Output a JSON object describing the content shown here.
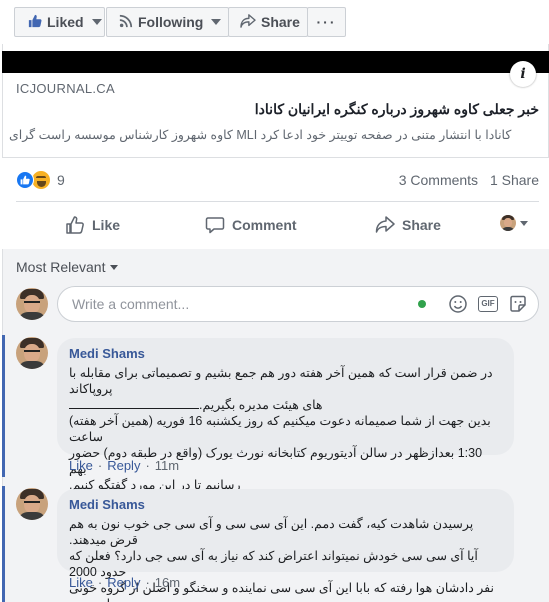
{
  "page_actions": {
    "liked_label": "Liked",
    "following_label": "Following",
    "share_label": "Share",
    "more_label": "···"
  },
  "link_preview": {
    "domain": "ICJOURNAL.CA",
    "title": "خبر جعلی کاوه شهروز درباره کنگره ایرانیان کانادا",
    "description": "کانادا با انتشار متنی در صفحه توییتر خود ادعا کرد MLI کاوه شهروز کارشناس موسسه راست گرای",
    "info_label": "i"
  },
  "reactions": {
    "count": "9",
    "comments": "3 Comments",
    "shares": "1 Share"
  },
  "actions": {
    "like": "Like",
    "comment": "Comment",
    "share": "Share"
  },
  "comments_section": {
    "sort_label": "Most Relevant",
    "placeholder": "Write a comment...",
    "comments": [
      {
        "author": "Medi Shams",
        "line1": "در ضمن قرار است که همین آخر هفته دور هم جمع بشیم و تصمیماتی برای مقابله با پروپاکاند",
        "line2": "های هیئت مدیره بگیریم.",
        "line3": "بدین جهت از شما صمیمانه دعوت میکنیم که روز یکشنبه 16 فوریه (همین آخر هفته) ساعت",
        "line4": "1:30 بعدازظهر در سالن آدیتوریوم کتابخانه نورث یورک (واقع در طبقه دوم) حضور بهم",
        "line5": "رسانیم تا در این مورد گفتگو کنیم.",
        "like": "Like",
        "reply": "Reply",
        "time": "11m"
      },
      {
        "author": "Medi Shams",
        "line1": "پرسیدن شاهدت کیه، گفت دمم. این آی سی سی و آی سی جی خوب نون به هم قرض میدهند.",
        "line2": "آیا آی سی سی خودش نمیتواند اعتراض کند که نیاز به آی سی جی دارد؟ فعلن که حدود 2000",
        "line3": "نفر دادشان هوا رفته که بابا این آی سی سی نماینده و سخنگو و اصلن از گروه خونی ما نیست.",
        "like": "Like",
        "reply": "Reply",
        "time": "16m"
      }
    ]
  }
}
